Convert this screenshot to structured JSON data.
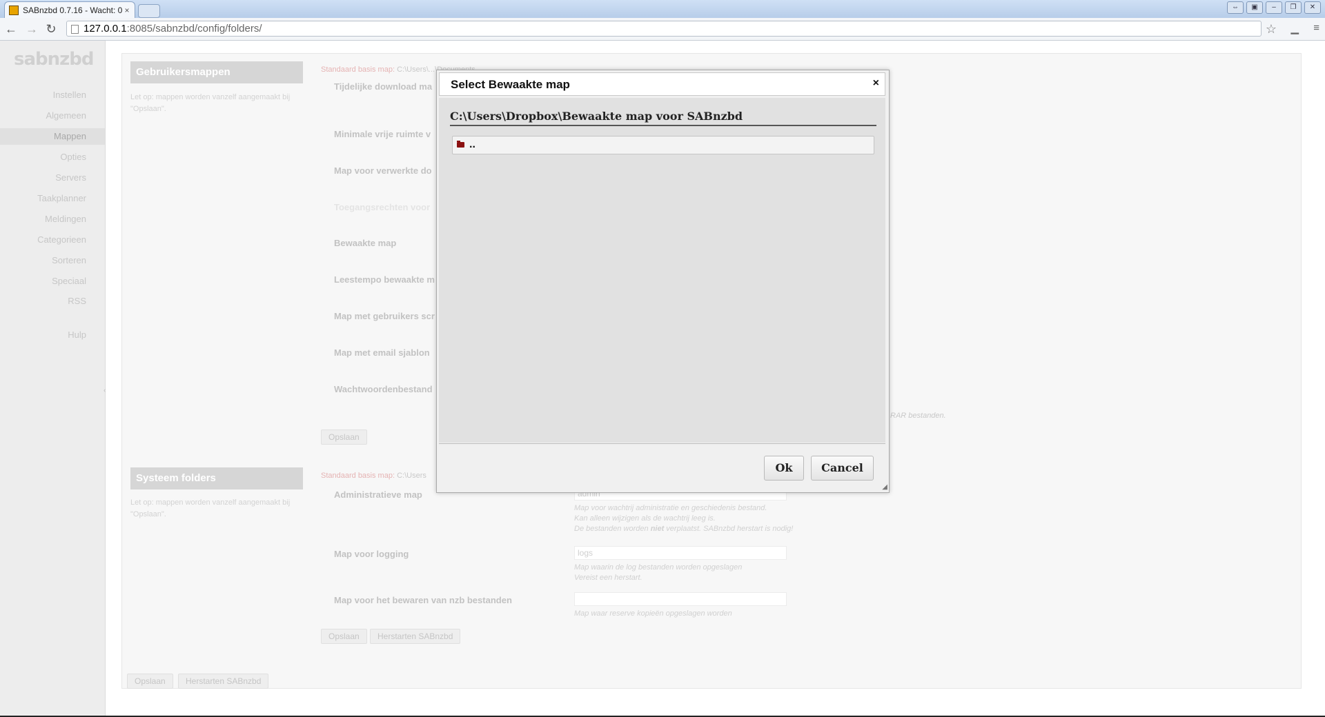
{
  "browser": {
    "tab_title": "SABnzbd 0.7.16 - Wacht: 0",
    "tab_close": "×",
    "url_host": "127.0.0.1",
    "url_rest": ":8085/sabnzbd/config/folders/",
    "window_buttons": [
      "⇔",
      "▣",
      "–",
      "❐",
      "✕"
    ]
  },
  "sidebar": {
    "logo": "sabnzbd",
    "items": [
      "Instellen",
      "Algemeen",
      "Mappen",
      "Opties",
      "Servers",
      "Taakplanner",
      "Meldingen",
      "Categorieen",
      "Sorteren",
      "Speciaal",
      "RSS",
      "Hulp"
    ],
    "active": "Mappen"
  },
  "user_folders": {
    "header": "Gebruikersmappen",
    "note": "Let op: mappen worden vanzelf aangemaakt bij \"Opslaan\".",
    "std_label": "Standaard basis map:",
    "std_value": "C:\\Users\\...\\Documents",
    "fields": [
      "Tijdelijke download ma",
      "Minimale vrije ruimte v",
      "Map voor verwerkte do",
      "Toegangsrechten voor",
      "Bewaakte map",
      "Leestempo bewaakte m",
      "Map met gebruikers scr",
      "Map met email sjablon",
      "Wachtwoordenbestand"
    ],
    "rar_note": "RAR bestanden.",
    "save_button": "Opslaan"
  },
  "system_folders": {
    "header": "Systeem folders",
    "note": "Let op: mappen worden vanzelf aangemaakt bij \"Opslaan\".",
    "std_label": "Standaard basis map:",
    "std_value": "C:\\Users",
    "admin_label": "Administratieve map",
    "admin_value": "admin",
    "admin_desc1": "Map voor wachtrij administratie en geschiedenis bestand.",
    "admin_desc2": "Kan alleen wijzigen als de wachtrij leeg is.",
    "admin_desc3a": "De bestanden worden ",
    "admin_desc3b": "niet",
    "admin_desc3c": " verplaatst. SABnzbd herstart is nodig!",
    "log_label": "Map voor logging",
    "log_value": "logs",
    "log_desc1": "Map waarin de log bestanden worden opgeslagen",
    "log_desc2": "Vereist een herstart.",
    "nzb_label": "Map voor het bewaren van nzb bestanden",
    "nzb_value": "",
    "nzb_desc": "Map waar reserve kopieën opgeslagen worden",
    "save_button": "Opslaan",
    "restart_button": "Herstarten SABnzbd"
  },
  "footer_buttons": {
    "save": "Opslaan",
    "restart": "Herstarten SABnzbd"
  },
  "dialog": {
    "title": "Select Bewaakte map",
    "close": "×",
    "path": "C:\\Users\\Dropbox\\Bewaakte map voor SABnzbd",
    "entries": [
      ".."
    ],
    "ok": "Ok",
    "cancel": "Cancel"
  }
}
